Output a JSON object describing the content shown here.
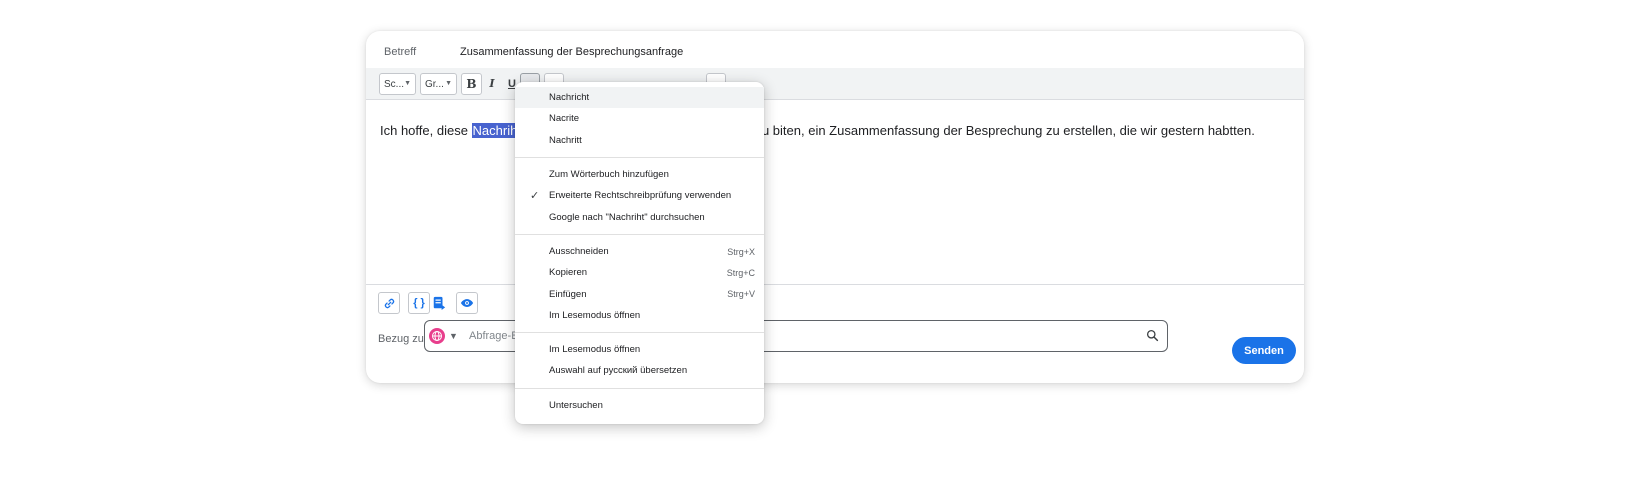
{
  "composer": {
    "subject_label": "Betreff",
    "subject_value": "Zusammenfassung der Besprechungsanfrage",
    "toolbar": {
      "font_select": "Sc...",
      "size_select": "Gr...",
      "bold": "B",
      "italic": "I",
      "underline": "U"
    },
    "body": {
      "prefix": "Ich hoffe, diese ",
      "selected_word": "Nachriht",
      "suffix": "u biten, ein Zusammenfassung der Besprechung zu erstellen, die wir gestern habtten."
    },
    "bottom_tools": {
      "link_icon": "link-icon",
      "braces_label": "{ }",
      "doc_icon": "document-add-icon",
      "eye_icon": "eye-icon"
    },
    "reference": {
      "label": "Bezug zu",
      "placeholder": "Abfrage-E"
    },
    "send_label": "Senden"
  },
  "context_menu": {
    "groups": [
      [
        {
          "label": "Nachricht",
          "shortcut": "",
          "checked": false,
          "highlighted": true
        },
        {
          "label": "Nacrite",
          "shortcut": "",
          "checked": false,
          "highlighted": false
        },
        {
          "label": "Nachritt",
          "shortcut": "",
          "checked": false,
          "highlighted": false
        }
      ],
      [
        {
          "label": "Zum Wörterbuch hinzufügen",
          "shortcut": "",
          "checked": false,
          "highlighted": false
        },
        {
          "label": "Erweiterte Rechtschreibprüfung verwenden",
          "shortcut": "",
          "checked": true,
          "highlighted": false
        },
        {
          "label": "Google nach \"Nachriht\" durchsuchen",
          "shortcut": "",
          "checked": false,
          "highlighted": false
        }
      ],
      [
        {
          "label": "Ausschneiden",
          "shortcut": "Strg+X",
          "checked": false,
          "highlighted": false
        },
        {
          "label": "Kopieren",
          "shortcut": "Strg+C",
          "checked": false,
          "highlighted": false
        },
        {
          "label": "Einfügen",
          "shortcut": "Strg+V",
          "checked": false,
          "highlighted": false
        },
        {
          "label": "Im Lesemodus öffnen",
          "shortcut": "",
          "checked": false,
          "highlighted": false
        }
      ],
      [
        {
          "label": "Im Lesemodus öffnen",
          "shortcut": "",
          "checked": false,
          "highlighted": false
        },
        {
          "label": "Auswahl auf русский übersetzen",
          "shortcut": "",
          "checked": false,
          "highlighted": false
        }
      ],
      [
        {
          "label": "Untersuchen",
          "shortcut": "",
          "checked": false,
          "highlighted": false
        }
      ]
    ],
    "check_glyph": "✓"
  },
  "colors": {
    "accent": "#1a73e8",
    "selection": "#4863cf",
    "menu_highlight": "#f1f3f4"
  }
}
